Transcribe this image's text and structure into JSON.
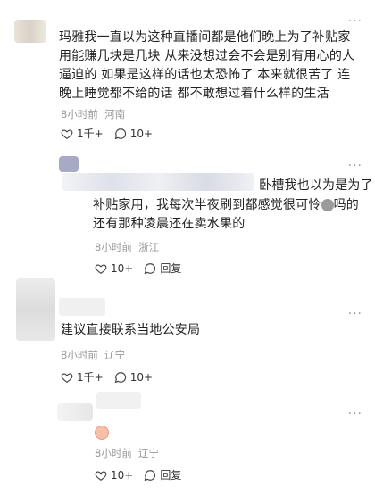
{
  "comments": [
    {
      "text": "玛雅我一直以为这种直播间都是他们晚上为了补贴家用能赚几块是几块 从来没想过会不会是别有用心的人逼迫的 如果是这样的话也太恐怖了 本来就很苦了 连晚上睡觉都不给的话 都不敢想过着什么样的生活",
      "time": "8小时前",
      "location": "河南",
      "likes": "1千+",
      "replies": "10+"
    },
    {
      "text_line1": "卧槽我也以为是为了",
      "text_line2a": "补贴家用，我每次半夜刷到都感觉很可怜",
      "text_line2b": "吗的",
      "text_line3": "还有那种凌晨还在卖水果的",
      "time": "8小时前",
      "location": "浙江",
      "likes": "10+",
      "reply_label": "回复"
    },
    {
      "text": "建议直接联系当地公安局",
      "time": "8小时前",
      "location": "辽宁",
      "likes": "1千+",
      "replies": "10+"
    },
    {
      "time": "8小时前",
      "location": "辽宁",
      "likes": "10+",
      "reply_label": "回复"
    }
  ],
  "more_label": "···"
}
